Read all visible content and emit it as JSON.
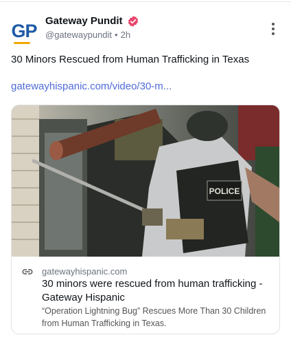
{
  "post": {
    "author_name": "Gateway Pundit",
    "handle": "@gatewaypundit",
    "separator": "•",
    "time": "2h",
    "avatar_text": "GP",
    "text": "30 Minors Rescued from Human Trafficking in Texas",
    "link_text": "gatewayhispanic.com/video/30-m..."
  },
  "card": {
    "domain": "gatewayhispanic.com",
    "title": "30 minors were rescued from human trafficking - Gateway Hispanic",
    "description": "“Operation Lightning Bug” Rescues More Than 30 Children from Human Trafficking in Texas.",
    "image_vest_text": "POLICE"
  },
  "icons": {
    "verified": "verified-badge-icon",
    "more": "more-options-icon",
    "link": "link-icon"
  },
  "colors": {
    "link": "#4f6bd8",
    "verified": "#e8456b",
    "avatar_blue": "#1f5aa6",
    "avatar_accent": "#f2a900"
  }
}
